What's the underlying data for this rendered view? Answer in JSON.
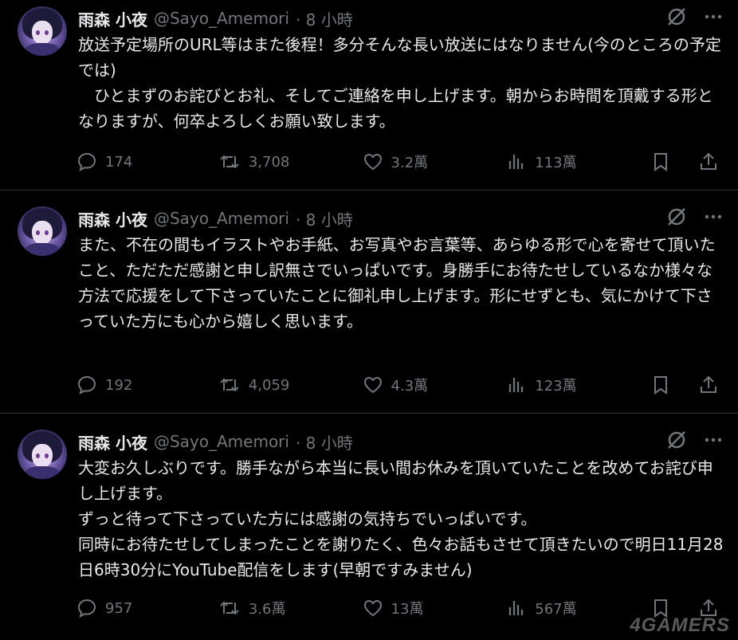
{
  "tweets": [
    {
      "name": "雨森 小夜",
      "handle": "@Sayo_Amemori",
      "time": "· 8 小時",
      "text": "放送予定場所のURL等はまた後程！多分そんな長い放送にはなりません(今のところの予定では)\n　ひとまずのお詫びとお礼、そしてご連絡を申し上げます。朝からお時間を頂戴する形となりますが、何卒よろしくお願い致します。",
      "replies": "174",
      "retweets": "3,708",
      "likes": "3.2萬",
      "views": "113萬"
    },
    {
      "name": "雨森 小夜",
      "handle": "@Sayo_Amemori",
      "time": "· 8 小時",
      "text": "また、不在の間もイラストやお手紙、お写真やお言葉等、あらゆる形で心を寄せて頂いたこと、ただただ感謝と申し訳無さでいっぱいです。身勝手にお待たせしているなか様々な方法で応援をして下さっていたことに御礼申し上げます。形にせずとも、気にかけて下さっていた方にも心から嬉しく思います。",
      "replies": "192",
      "retweets": "4,059",
      "likes": "4.3萬",
      "views": "123萬"
    },
    {
      "name": "雨森 小夜",
      "handle": "@Sayo_Amemori",
      "time": "· 8 小時",
      "text": "大変お久しぶりです。勝手ながら本当に長い間お休みを頂いていたことを改めてお詫び申し上げます。\nずっと待って下さっていた方には感謝の気持ちでいっぱいです。\n同時にお待たせしてしまったことを謝りたく、色々お話もさせて頂きたいので明日11月28日6時30分にYouTube配信をします(早朝ですみません)",
      "replies": "957",
      "retweets": "3.6萬",
      "likes": "13萬",
      "views": "567萬"
    }
  ],
  "watermark": "4GAMERS",
  "colors": {
    "background": "#000000",
    "text": "#e7e9ea",
    "muted": "#71767b",
    "divider": "#2f3336"
  }
}
